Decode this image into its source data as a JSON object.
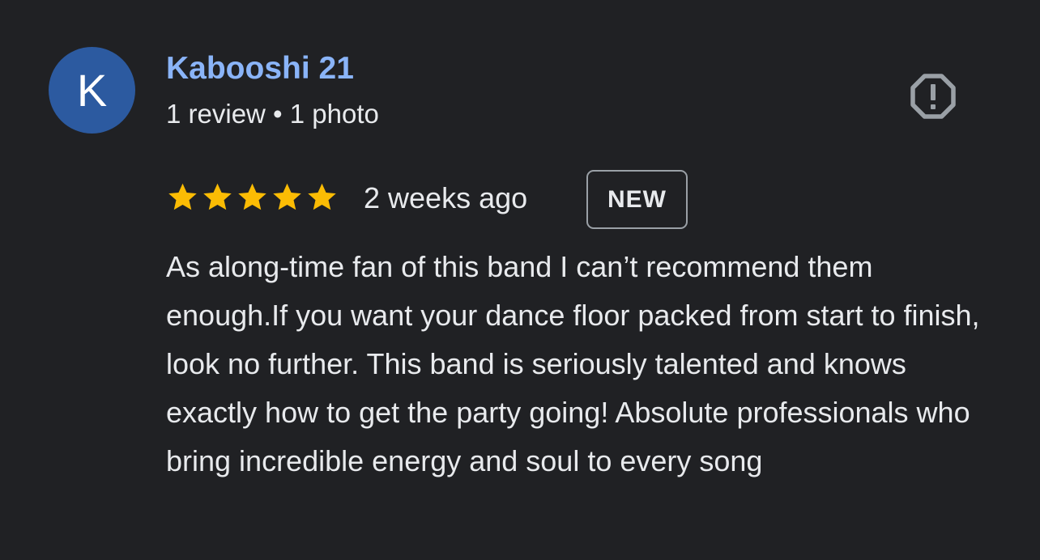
{
  "author": {
    "initial": "K",
    "name": "Kabooshi 21",
    "meta": "1 review • 1 photo"
  },
  "review": {
    "rating": 5,
    "rating_max": 5,
    "time": "2 weeks ago",
    "badge": "NEW",
    "text": "As along-time fan of this band I can’t recommend them enough.If you want your dance floor packed from start to finish, look no further. This band is seriously talented and knows exactly how to get the party going! Absolute professionals who bring incredible energy and soul to every song"
  },
  "icons": {
    "report": "report-flag-icon",
    "star": "star-icon"
  },
  "colors": {
    "background": "#202124",
    "avatar": "#2c5aa0",
    "author_name": "#8ab4f8",
    "star": "#fbbc04",
    "text": "#e8eaed",
    "icon_gray": "#9aa0a6"
  }
}
